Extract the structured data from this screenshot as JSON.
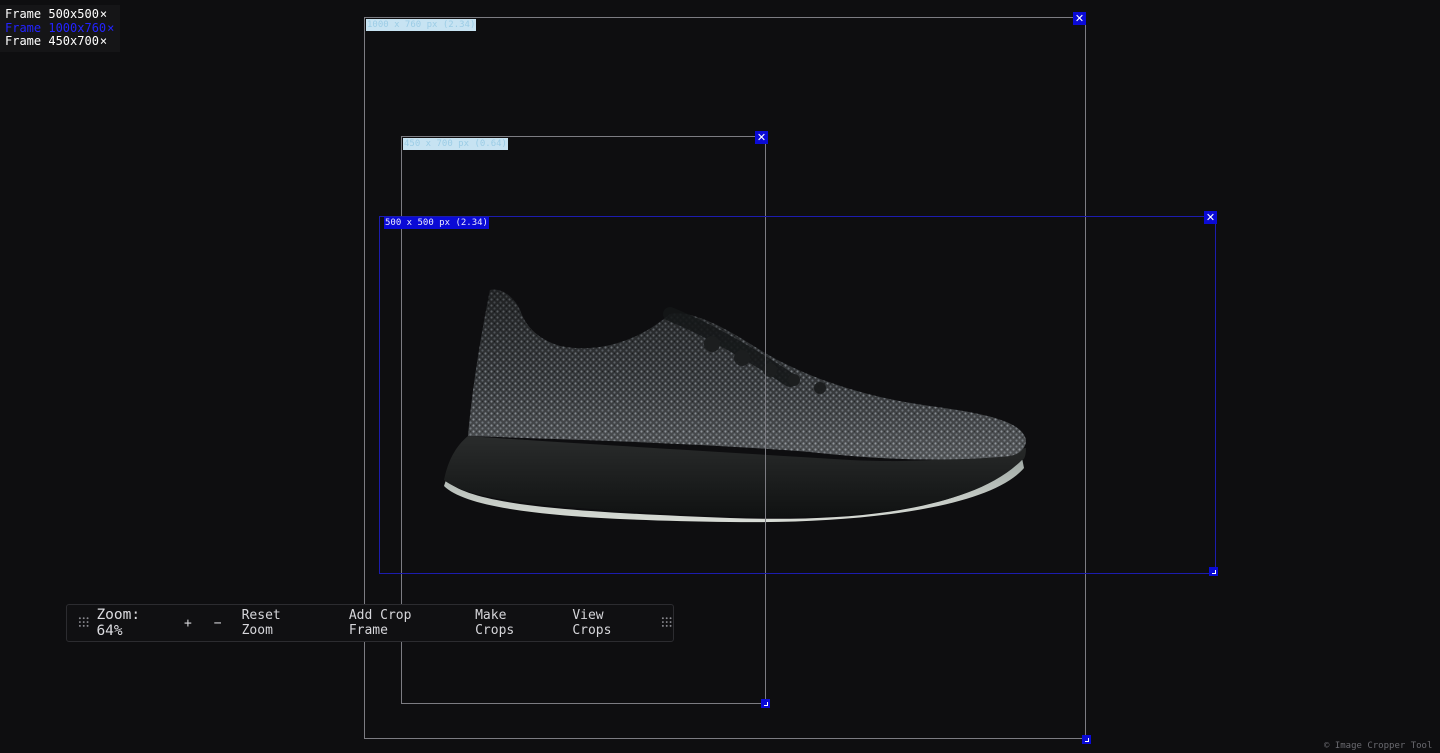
{
  "frame_list": [
    {
      "label": "Frame 500x500",
      "remove": "×",
      "active": false
    },
    {
      "label": "Frame 1000x760",
      "remove": "×",
      "active": true
    },
    {
      "label": "Frame 450x700",
      "remove": "×",
      "active": false
    }
  ],
  "crop_frames": [
    {
      "label": "1000 x 760 px (2.34)",
      "close": "✕"
    },
    {
      "label": "450 x 700 px (0.64)",
      "close": "✕"
    },
    {
      "label": "500 x 500 px (2.34)",
      "close": "✕"
    }
  ],
  "toolbar": {
    "zoom_label": "Zoom: 64%",
    "zoom_in": "+",
    "zoom_out": "−",
    "reset_zoom": "Reset Zoom",
    "add_crop_frame": "Add Crop Frame",
    "make_crops": "Make Crops",
    "view_crops": "View Crops"
  },
  "footer": "© Image Cropper Tool",
  "colors": {
    "background": "#0e0e10",
    "accent": "#0a0ad6",
    "frame_border": "#7c7c82"
  }
}
